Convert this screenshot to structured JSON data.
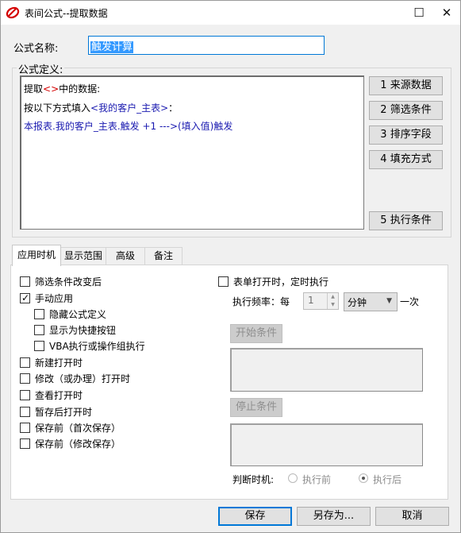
{
  "window": {
    "title": "表间公式--提取数据",
    "maximize_glyph": "☐",
    "close_glyph": "✕"
  },
  "formula_name": {
    "label": "公式名称:",
    "value": "触发计算"
  },
  "definition": {
    "group_label": "公式定义:",
    "line1": {
      "prefix": "提取",
      "token": "<>",
      "suffix": "中的数据:"
    },
    "line2": {
      "prefix": "按以下方式填入",
      "target": "<我的客户_主表>",
      "suffix": "："
    },
    "line3": "本报表.我的客户_主表.触发 +1   --->(填入值)触发"
  },
  "side_buttons": {
    "source": "1  来源数据",
    "filter": "2  筛选条件",
    "sort": "3  排序字段",
    "fill": "4 填充方式",
    "exec": "5 执行条件"
  },
  "tabs": [
    "应用时机",
    "显示范围",
    "高级",
    "备注"
  ],
  "timing": {
    "filter_change": {
      "label": "筛选条件改变后",
      "checked": false
    },
    "manual": {
      "label": "手动应用",
      "checked": true
    },
    "hide_def": {
      "label": "隐藏公式定义",
      "checked": false
    },
    "shortcut": {
      "label": "显示为快捷按钮",
      "checked": false
    },
    "vba": {
      "label": "VBA执行或操作组执行",
      "checked": false
    },
    "new_open": {
      "label": "新建打开时",
      "checked": false
    },
    "edit_open": {
      "label": "修改（或办理）打开时",
      "checked": false
    },
    "view_open": {
      "label": "查看打开时",
      "checked": false
    },
    "draft_open": {
      "label": "暂存后打开时",
      "checked": false
    },
    "save_first": {
      "label": "保存前（首次保存）",
      "checked": false
    },
    "save_edit": {
      "label": "保存前（修改保存）",
      "checked": false
    },
    "timer": {
      "label": "表单打开时，定时执行",
      "checked": false
    }
  },
  "frequency": {
    "label": "执行频率：每",
    "value": "1",
    "unit": "分钟",
    "suffix": "一次"
  },
  "start_condition": "开始条件",
  "stop_condition": "停止条件",
  "judge": {
    "label": "判断时机:",
    "before": "执行前",
    "after": "执行后",
    "selected": "after"
  },
  "footer": {
    "save": "保存",
    "save_as": "另存为...",
    "cancel": "取消"
  }
}
